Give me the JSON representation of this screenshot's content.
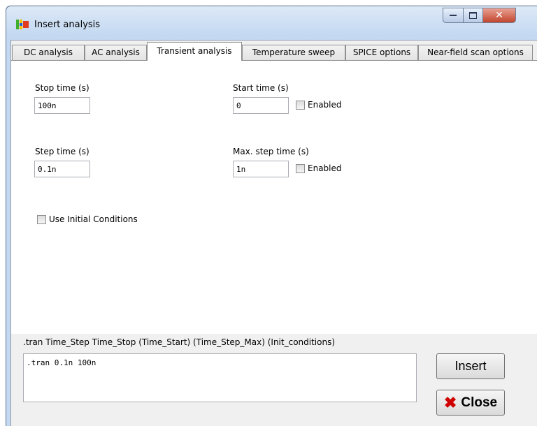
{
  "window": {
    "title": "Insert analysis"
  },
  "title_controls": {
    "minimize": "–",
    "maximize": "□",
    "close": "✕"
  },
  "tabs": [
    {
      "label": "DC analysis"
    },
    {
      "label": "AC analysis"
    },
    {
      "label": "Transient analysis",
      "active": true
    },
    {
      "label": "Temperature sweep"
    },
    {
      "label": "SPICE options"
    },
    {
      "label": "Near-field scan options"
    }
  ],
  "transient": {
    "stop_time": {
      "label": "Stop time (s)",
      "value": "100n"
    },
    "start_time": {
      "label": "Start time (s)",
      "value": "0",
      "enabled_label": "Enabled"
    },
    "step_time": {
      "label": "Step time (s)",
      "value": "0.1n"
    },
    "max_step_time": {
      "label": "Max. step time (s)",
      "value": "1n",
      "enabled_label": "Enabled"
    },
    "use_initial_conditions": {
      "label": "Use Initial Conditions"
    }
  },
  "command": {
    "syntax": ".tran Time_Step Time_Stop (Time_Start) (Time_Step_Max) (Init_conditions)",
    "value": ".tran 0.1n 100n"
  },
  "buttons": {
    "insert": "Insert",
    "close": "Close"
  },
  "colors": {
    "close_x": "#d10000",
    "titlebar": "#c4d9f1",
    "close_button": "#c2452d"
  }
}
